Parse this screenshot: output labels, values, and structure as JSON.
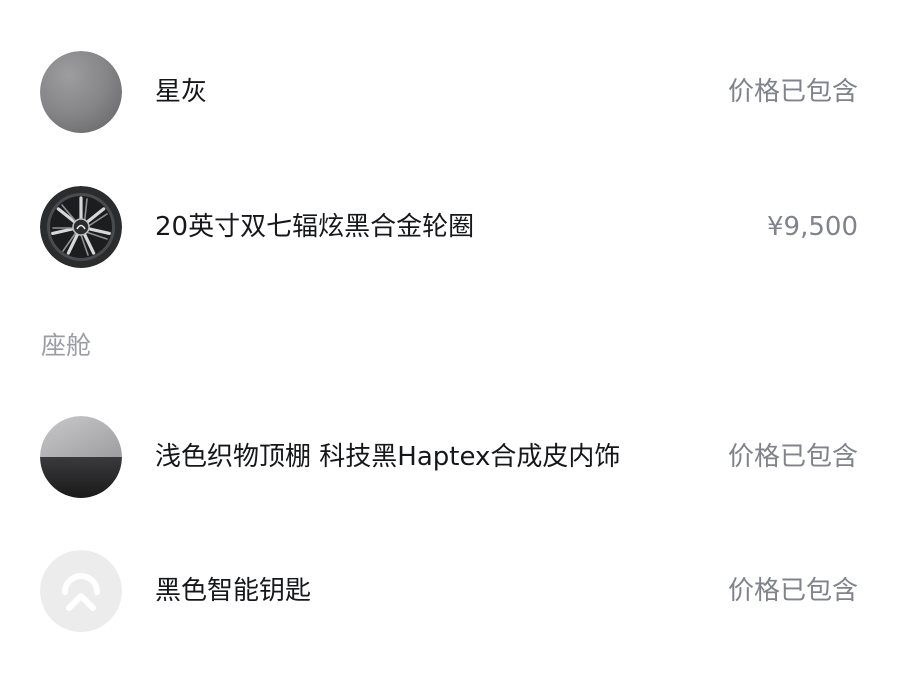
{
  "items": [
    {
      "swatch": "paint-grey-swatch",
      "name": "星灰",
      "price": "价格已包含",
      "swatch_color": "#8a8a8c"
    },
    {
      "swatch": "wheel-icon",
      "name": "20英寸双七辐炫黑合金轮圈",
      "price": "¥9,500"
    }
  ],
  "cabin": {
    "section_title": "座舱",
    "items": [
      {
        "swatch": "interior-two-tone-swatch",
        "name": "浅色织物顶棚 科技黑Haptex合成皮内饰",
        "price": "价格已包含"
      },
      {
        "swatch": "nio-logo-icon",
        "name": "黑色智能钥匙",
        "price": "价格已包含"
      }
    ]
  },
  "colors": {
    "text_primary": "#16171a",
    "text_secondary": "#80838c",
    "section_title": "#9a9da6",
    "background": "#ffffff"
  }
}
